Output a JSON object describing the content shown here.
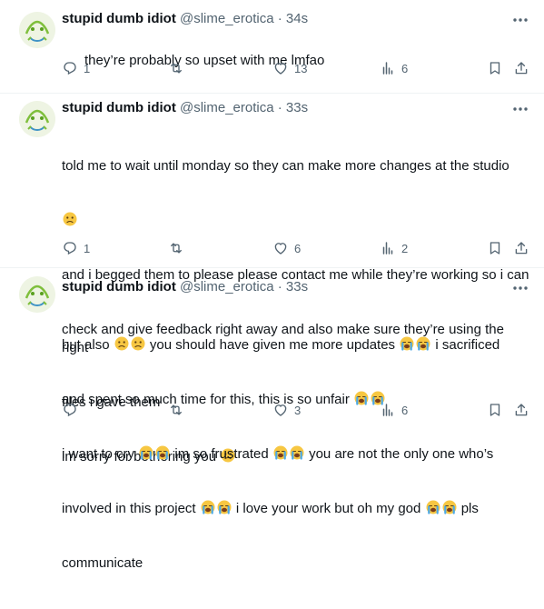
{
  "tweets": [
    {
      "name": "stupid dumb idiot",
      "handle": "@slime_erotica",
      "dot": "·",
      "time": "34s",
      "lines": [
        "they’re probably so upset with me lmfao"
      ],
      "reply_count": "1",
      "retweet_count": "",
      "like_count": "13",
      "view_count": "6"
    },
    {
      "name": "stupid dumb idiot",
      "handle": "@slime_erotica",
      "dot": "·",
      "time": "33s",
      "lines": [
        "told me to wait until monday so they can make more changes at the studio",
        "and i begged them to please please contact me while they’re working so i can",
        "check and give feedback right away and also make sure they’re using the right",
        "files i gave them",
        "im sorry for bothering you"
      ],
      "reply_count": "1",
      "retweet_count": "",
      "like_count": "6",
      "view_count": "2"
    },
    {
      "name": "stupid dumb idiot",
      "handle": "@slime_erotica",
      "dot": "·",
      "time": "33s",
      "lines": [
        "but also",
        "you should have given me more updates",
        "i sacrificed",
        "and spent so much time for this, this is so unfair",
        "i want to cry",
        "im so frustrated",
        "you are not the only one who’s",
        "involved in this project",
        "i love your work but oh my god",
        "pls",
        "communicate"
      ],
      "reply_count": "",
      "retweet_count": "",
      "like_count": "3",
      "view_count": "6"
    }
  ],
  "icons": {
    "reply": "reply-icon",
    "retweet": "retweet-icon",
    "like": "heart-icon",
    "views": "views-icon",
    "bookmark": "bookmark-icon",
    "share": "share-icon",
    "more": "more-icon",
    "emoji_worried": "worried-face-emoji",
    "emoji_crying": "loudly-crying-face-emoji"
  },
  "colors": {
    "secondary_text": "#536471",
    "divider": "#eff3f4"
  }
}
